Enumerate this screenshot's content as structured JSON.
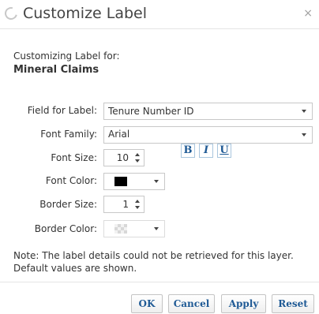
{
  "dialog": {
    "title": "Customize Label",
    "close_glyph": "×",
    "header_icon": "loading-spinner-icon"
  },
  "intro": {
    "label": "Customizing Label for:",
    "layer_name": "Mineral Claims"
  },
  "form": {
    "field_for_label": {
      "label": "Field for Label:",
      "value": "Tenure Number ID"
    },
    "font_family": {
      "label": "Font Family:",
      "value": "Arial"
    },
    "font_size": {
      "label": "Font Size:",
      "value": "10"
    },
    "format_buttons": {
      "bold": "B",
      "italic": "I",
      "underline": "U"
    },
    "font_color": {
      "label": "Font Color:",
      "value": "#000000"
    },
    "border_size": {
      "label": "Border Size:",
      "value": "1"
    },
    "border_color": {
      "label": "Border Color:",
      "value": "transparent"
    }
  },
  "note": "Note: The label details could not be retrieved for this layer. Default values are shown.",
  "footer": {
    "ok": "OK",
    "cancel": "Cancel",
    "apply": "Apply",
    "reset": "Reset"
  },
  "colors": {
    "accent": "#1f5a95",
    "border": "#c8c8c8"
  }
}
